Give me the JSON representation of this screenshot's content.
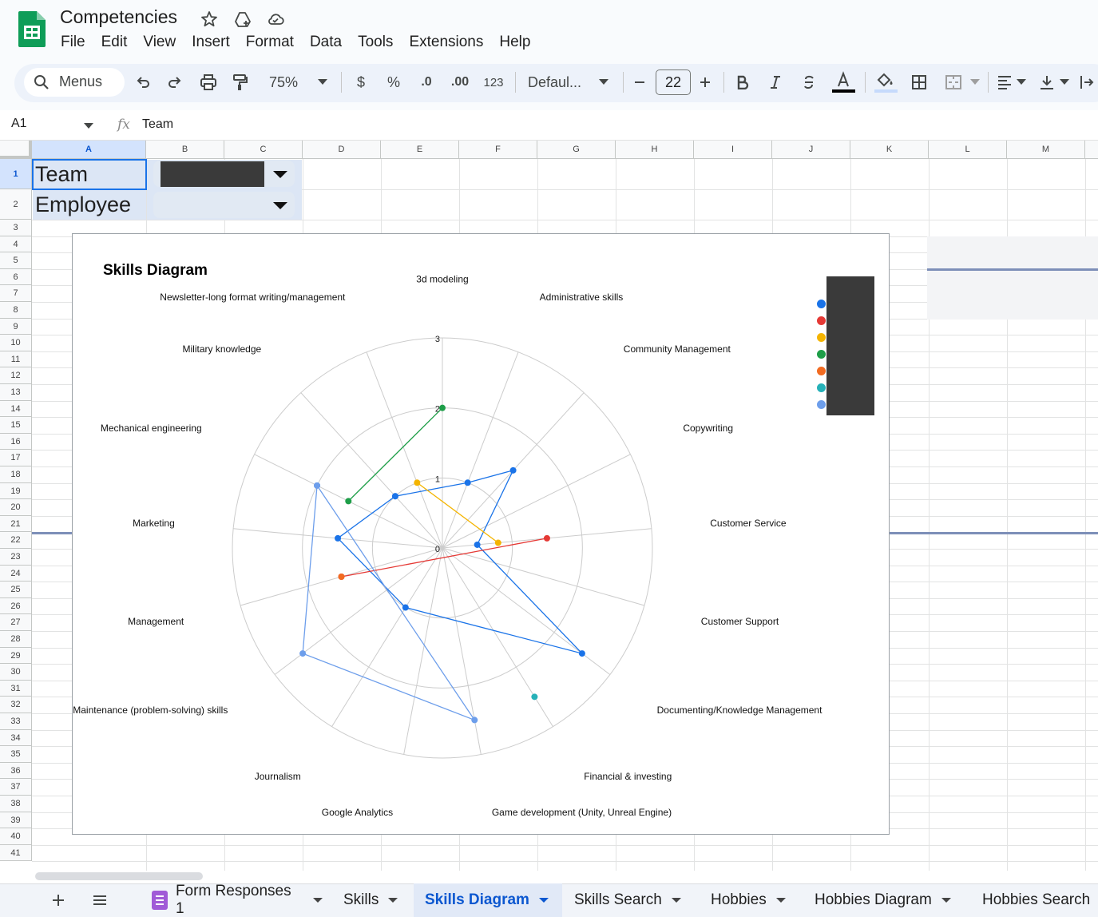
{
  "app": {
    "title": "Competencies",
    "menus": [
      "File",
      "Edit",
      "View",
      "Insert",
      "Format",
      "Data",
      "Tools",
      "Extensions",
      "Help"
    ]
  },
  "toolbar": {
    "search_label": "Menus",
    "zoom": "75%",
    "currency": "$",
    "percent": "%",
    "dec_decrease": ".0",
    "dec_increase": ".00",
    "number_format": "123",
    "font": "Defaul...",
    "font_size": "22"
  },
  "formula_bar": {
    "cell_ref": "A1",
    "fx": "fx",
    "value": "Team"
  },
  "grid": {
    "columns": [
      "A",
      "B",
      "C",
      "D",
      "E",
      "F",
      "G",
      "H",
      "I",
      "J",
      "K",
      "L",
      "M"
    ],
    "rows": [
      "1",
      "2",
      "3",
      "4",
      "5",
      "6",
      "7",
      "8",
      "9",
      "10",
      "11",
      "12",
      "13",
      "14",
      "15",
      "16",
      "17",
      "18",
      "19",
      "20",
      "21",
      "22",
      "23",
      "24",
      "25",
      "26",
      "27",
      "28",
      "29",
      "30",
      "31",
      "32",
      "33",
      "34",
      "35",
      "36",
      "37",
      "38",
      "39",
      "40",
      "41"
    ],
    "cells": {
      "a1": "Team",
      "a2": "Employee"
    }
  },
  "chart_data": {
    "type": "radar",
    "title": "Skills Diagram",
    "rlim": [
      0,
      3
    ],
    "rticks": [
      "0",
      "1",
      "2",
      "3"
    ],
    "grid": true,
    "legend_position": "right",
    "categories": [
      "3d modeling",
      "Administrative skills",
      "Community Management",
      "Copywriting",
      "Customer Service",
      "Customer Support",
      "Documenting/Knowledge Management",
      "Financial & investing",
      "Game development (Unity, Unreal Engine)",
      "Google Analytics",
      "Journalism",
      "Maintenance (problem-solving) skills",
      "Management",
      "Marketing",
      "Mechanical engineering",
      "Military knowledge",
      "Newsletter-long format writing/management"
    ],
    "series": [
      {
        "color": "#1a73e8",
        "points": [
          [
            15,
            1
          ],
          [
            1,
            1
          ],
          [
            2,
            1.5
          ],
          [
            4,
            0.5
          ],
          [
            6,
            2.5
          ],
          [
            10,
            1
          ],
          [
            13,
            1.5
          ],
          [
            15,
            1
          ]
        ]
      },
      {
        "color": "#e53935",
        "points": [
          [
            4,
            1.5
          ],
          [
            12,
            1.5
          ]
        ]
      },
      {
        "color": "#f4b400",
        "points": [
          [
            16,
            1
          ],
          [
            4,
            0.8
          ]
        ]
      },
      {
        "color": "#1e9e48",
        "points": [
          [
            0,
            2
          ],
          [
            14,
            1.5
          ]
        ]
      },
      {
        "color": "#f26b21",
        "points": [
          [
            12,
            1.5
          ]
        ]
      },
      {
        "color": "#26b1b8",
        "points": [
          [
            7,
            2.5
          ]
        ]
      },
      {
        "color": "#6d9eeb",
        "points": [
          [
            14,
            2
          ],
          [
            8,
            2.5
          ],
          [
            11,
            2.5
          ],
          [
            14,
            2
          ]
        ]
      }
    ]
  },
  "sheets": [
    {
      "name": "Form Responses 1",
      "active": false
    },
    {
      "name": "Skills",
      "active": false
    },
    {
      "name": "Skills Diagram",
      "active": true
    },
    {
      "name": "Skills Search",
      "active": false
    },
    {
      "name": "Hobbies",
      "active": false
    },
    {
      "name": "Hobbies Diagram",
      "active": false
    },
    {
      "name": "Hobbies Search",
      "active": false
    }
  ],
  "icons": {
    "logo": "sheets-logo-icon",
    "star": "star-icon",
    "move": "move-to-drive-icon",
    "cloud": "cloud-status-icon",
    "add_sheet": "plus-icon",
    "all_sheets": "hamburger-icon"
  }
}
